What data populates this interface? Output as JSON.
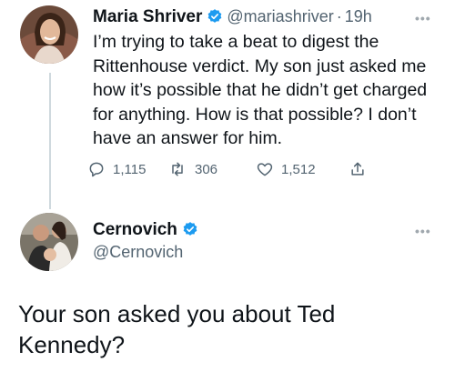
{
  "tweet1": {
    "author_name": "Maria Shriver",
    "handle": "@mariashriver",
    "separator": "·",
    "time": "19h",
    "text": "I’m trying to take a beat to digest the Rittenhouse verdict. My son just asked me how it’s possible that he didn’t get charged for anything. How is that possible? I don’t have an answer for him.",
    "actions": {
      "reply_count": "1,115",
      "retweet_count": "306",
      "like_count": "1,512"
    },
    "more_icon": "ellipsis-icon",
    "verified_icon": "verified-badge-icon"
  },
  "tweet2": {
    "author_name": "Cernovich",
    "handle": "@Cernovich",
    "text": "Your son asked you about Ted Kennedy?",
    "more_icon": "ellipsis-icon",
    "verified_icon": "verified-badge-icon"
  },
  "colors": {
    "text": "#0f1419",
    "muted": "#536471",
    "verified": "#1d9bf0",
    "thread_line": "#cfd9de"
  }
}
